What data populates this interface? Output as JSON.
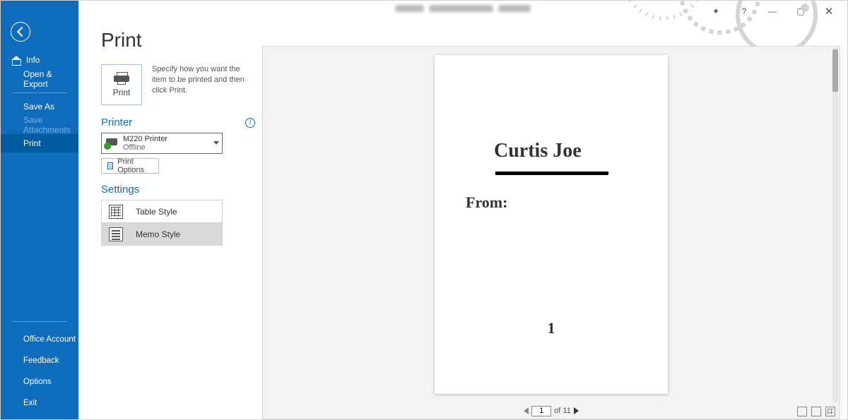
{
  "sidebar": {
    "info": "Info",
    "open_export": "Open & Export",
    "save_as": "Save As",
    "save_attachments": "Save Attachments",
    "print": "Print",
    "office_account": "Office Account",
    "feedback": "Feedback",
    "options": "Options",
    "exit": "Exit"
  },
  "page": {
    "title": "Print",
    "tile_label": "Print",
    "description": "Specify how you want the item to be printed and then click Print."
  },
  "printer": {
    "section": "Printer",
    "name": "M220 Printer",
    "status": "Offline",
    "options_btn": "Print Options"
  },
  "settings": {
    "section": "Settings",
    "styles": [
      {
        "label": "Table Style",
        "selected": false,
        "icon": "table"
      },
      {
        "label": "Memo Style",
        "selected": true,
        "icon": "memo"
      }
    ]
  },
  "preview": {
    "name": "Curtis Joe",
    "from_label": "From:",
    "page_number": "1"
  },
  "pager": {
    "current": "1",
    "total_label": "of 11"
  }
}
